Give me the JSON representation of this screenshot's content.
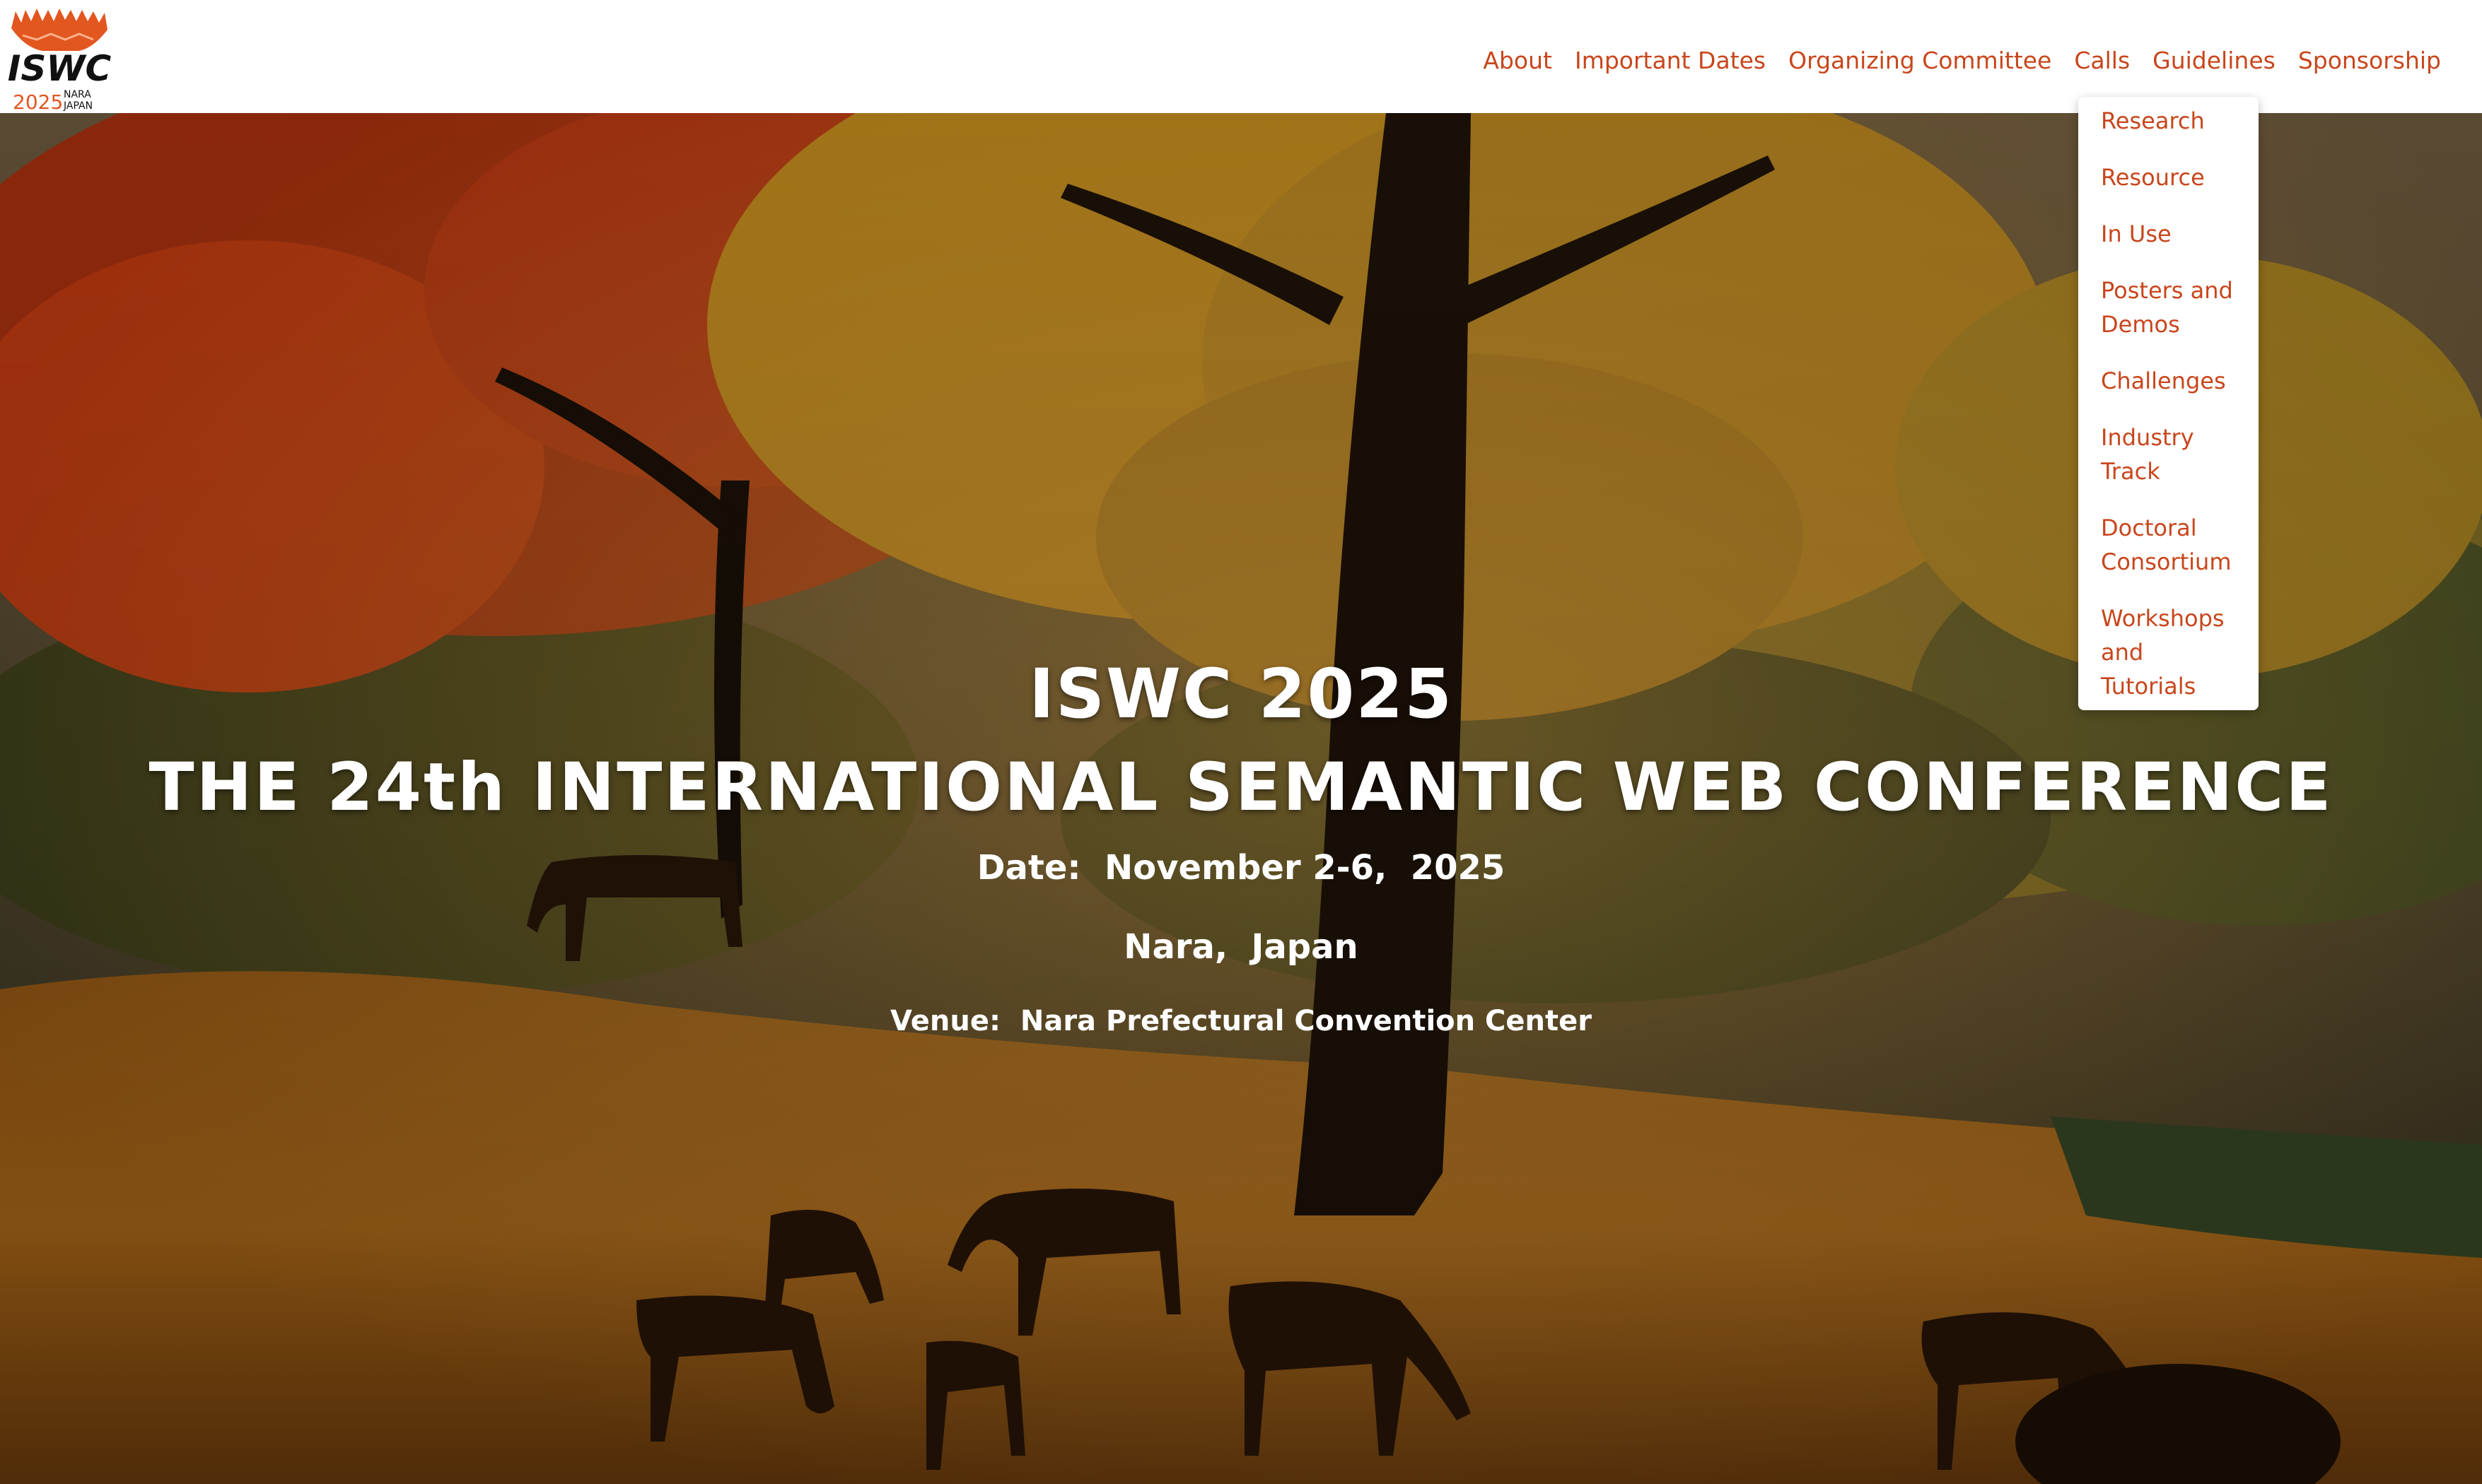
{
  "navbar": {
    "logo": {
      "text": "ISWC",
      "year": "2025",
      "place_line1": "NARA",
      "place_line2": "JAPAN",
      "accent": "#e2561f"
    },
    "links": [
      "About",
      "Important Dates",
      "Organizing Committee",
      "Calls",
      "Guidelines",
      "Sponsorship"
    ]
  },
  "dropdown": {
    "parent": "Calls",
    "items": [
      [
        "Research"
      ],
      [
        "Resource"
      ],
      [
        "In Use"
      ],
      [
        "Posters and",
        "Demos"
      ],
      [
        "Challenges"
      ],
      [
        "Industry",
        "Track"
      ],
      [
        "Doctoral",
        "Consortium"
      ],
      [
        "Workshops",
        "and",
        "Tutorials"
      ]
    ]
  },
  "hero": {
    "title": "ISWC 2025",
    "subtitle": "THE 24th INTERNATIONAL SEMANTIC WEB CONFERENCE",
    "date_line": "Date:  November 2-6,  2025",
    "location_line": "Nara,  Japan",
    "venue_line": "Venue:  Nara Prefectural Convention Center"
  },
  "colors": {
    "link": "#c8461c",
    "hero_text": "#ffffff"
  }
}
